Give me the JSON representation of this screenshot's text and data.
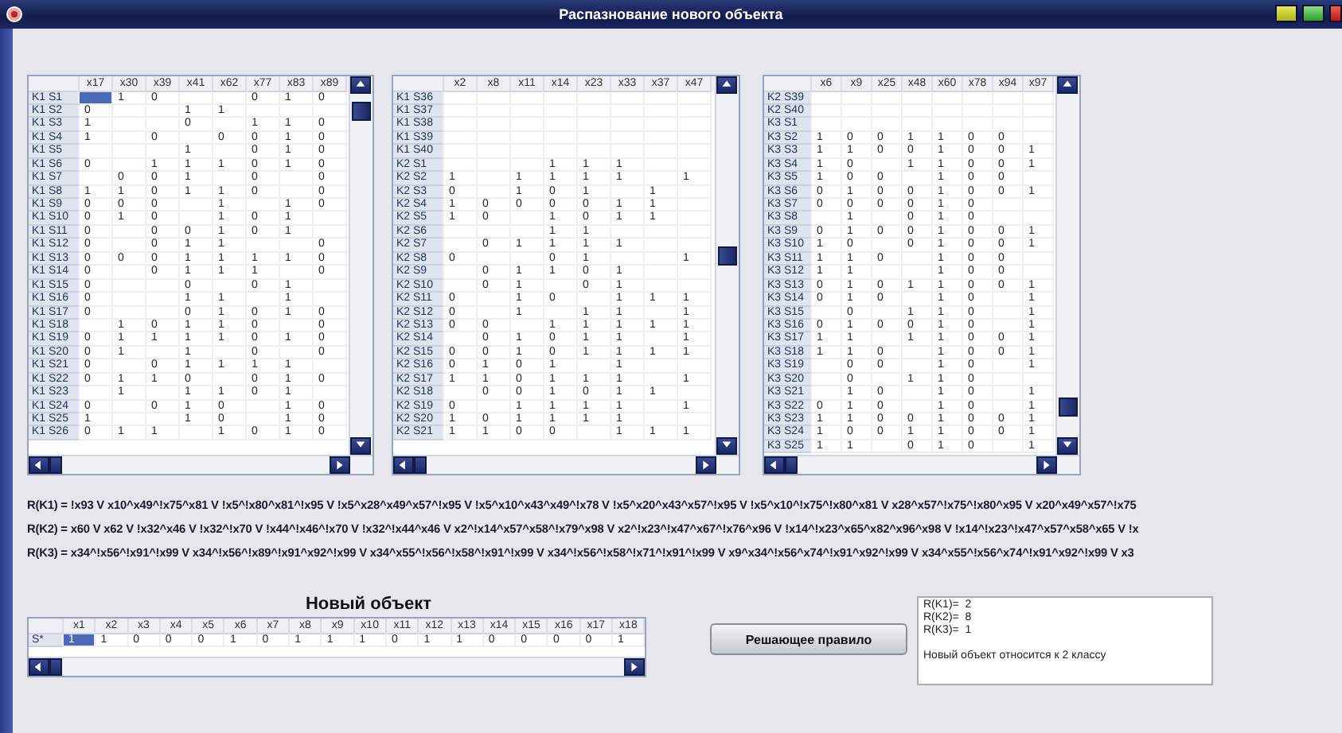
{
  "window": {
    "title": "Распазнование нового объекта"
  },
  "training_tables": [
    {
      "columns": [
        "x17",
        "x30",
        "x39",
        "x41",
        "x62",
        "x77",
        "x83",
        "x89"
      ],
      "rows": [
        {
          "label": "K1 S1",
          "selected": true,
          "cells": [
            null,
            "1",
            "0",
            null,
            null,
            "0",
            "1",
            "0"
          ]
        },
        {
          "label": "K1 S2",
          "selected": false,
          "cells": [
            "0",
            null,
            null,
            "1",
            "1",
            null,
            null,
            null
          ]
        },
        {
          "label": "K1 S3",
          "selected": false,
          "cells": [
            "1",
            null,
            null,
            "0",
            null,
            "1",
            "1",
            "0"
          ]
        },
        {
          "label": "K1 S4",
          "selected": false,
          "cells": [
            "1",
            null,
            "0",
            null,
            "0",
            "0",
            "1",
            "0"
          ]
        },
        {
          "label": "K1 S5",
          "selected": false,
          "cells": [
            null,
            null,
            null,
            "1",
            null,
            "0",
            "1",
            "0"
          ]
        },
        {
          "label": "K1 S6",
          "selected": false,
          "cells": [
            "0",
            null,
            "1",
            "1",
            "1",
            "0",
            "1",
            "0"
          ]
        },
        {
          "label": "K1 S7",
          "selected": false,
          "cells": [
            null,
            "0",
            "0",
            "1",
            null,
            "0",
            null,
            "0"
          ]
        },
        {
          "label": "K1 S8",
          "selected": false,
          "cells": [
            "1",
            "1",
            "0",
            "1",
            "1",
            "0",
            null,
            "0"
          ]
        },
        {
          "label": "K1 S9",
          "selected": false,
          "cells": [
            "0",
            "0",
            "0",
            null,
            "1",
            null,
            "1",
            "0"
          ]
        },
        {
          "label": "K1 S10",
          "selected": false,
          "cells": [
            "0",
            "1",
            "0",
            null,
            "1",
            "0",
            "1",
            null
          ]
        },
        {
          "label": "K1 S11",
          "selected": false,
          "cells": [
            "0",
            null,
            "0",
            "0",
            "1",
            "0",
            "1",
            null
          ]
        },
        {
          "label": "K1 S12",
          "selected": false,
          "cells": [
            "0",
            null,
            "0",
            "1",
            "1",
            null,
            null,
            "0"
          ]
        },
        {
          "label": "K1 S13",
          "selected": false,
          "cells": [
            "0",
            "0",
            "0",
            "1",
            "1",
            "1",
            "1",
            "0"
          ]
        },
        {
          "label": "K1 S14",
          "selected": false,
          "cells": [
            "0",
            null,
            "0",
            "1",
            "1",
            "1",
            null,
            "0"
          ]
        },
        {
          "label": "K1 S15",
          "selected": false,
          "cells": [
            "0",
            null,
            null,
            "0",
            null,
            "0",
            "1",
            null
          ]
        },
        {
          "label": "K1 S16",
          "selected": false,
          "cells": [
            "0",
            null,
            null,
            "1",
            "1",
            null,
            "1",
            null
          ]
        },
        {
          "label": "K1 S17",
          "selected": false,
          "cells": [
            "0",
            null,
            null,
            "0",
            "1",
            "0",
            "1",
            "0"
          ]
        },
        {
          "label": "K1 S18",
          "selected": false,
          "cells": [
            null,
            "1",
            "0",
            "1",
            "1",
            "0",
            null,
            "0"
          ]
        },
        {
          "label": "K1 S19",
          "selected": false,
          "cells": [
            "0",
            "1",
            "1",
            "1",
            "1",
            "0",
            "1",
            "0"
          ]
        },
        {
          "label": "K1 S20",
          "selected": false,
          "cells": [
            "0",
            "1",
            null,
            "1",
            null,
            "0",
            null,
            "0"
          ]
        },
        {
          "label": "K1 S21",
          "selected": false,
          "cells": [
            "0",
            null,
            "0",
            "1",
            "1",
            "1",
            "1",
            null
          ]
        },
        {
          "label": "K1 S22",
          "selected": false,
          "cells": [
            "0",
            "1",
            "1",
            "0",
            null,
            "0",
            "1",
            "0"
          ]
        },
        {
          "label": "K1 S23",
          "selected": false,
          "cells": [
            null,
            "1",
            null,
            "1",
            "1",
            "0",
            "1",
            null
          ]
        },
        {
          "label": "K1 S24",
          "selected": false,
          "cells": [
            "0",
            null,
            "0",
            "1",
            "0",
            null,
            "1",
            "0"
          ]
        },
        {
          "label": "K1 S25",
          "selected": false,
          "cells": [
            "1",
            null,
            null,
            "1",
            "0",
            null,
            "1",
            "0"
          ]
        },
        {
          "label": "K1 S26",
          "selected": false,
          "cells": [
            "0",
            "1",
            "1",
            null,
            "1",
            "0",
            "1",
            "0"
          ]
        }
      ]
    },
    {
      "columns": [
        "x2",
        "x8",
        "x11",
        "x14",
        "x23",
        "x33",
        "x37",
        "x47"
      ],
      "rows": [
        {
          "label": "K1 S36",
          "selected": false,
          "cells": [
            null,
            null,
            null,
            null,
            null,
            null,
            null,
            null
          ]
        },
        {
          "label": "K1 S37",
          "selected": false,
          "cells": [
            null,
            null,
            null,
            null,
            null,
            null,
            null,
            null
          ]
        },
        {
          "label": "K1 S38",
          "selected": false,
          "cells": [
            null,
            null,
            null,
            null,
            null,
            null,
            null,
            null
          ]
        },
        {
          "label": "K1 S39",
          "selected": false,
          "cells": [
            null,
            null,
            null,
            null,
            null,
            null,
            null,
            null
          ]
        },
        {
          "label": "K1 S40",
          "selected": false,
          "cells": [
            null,
            null,
            null,
            null,
            null,
            null,
            null,
            null
          ]
        },
        {
          "label": "K2 S1",
          "selected": false,
          "cells": [
            null,
            null,
            null,
            "1",
            "1",
            "1",
            null,
            null
          ]
        },
        {
          "label": "K2 S2",
          "selected": false,
          "cells": [
            "1",
            null,
            "1",
            "1",
            "1",
            "1",
            null,
            "1"
          ]
        },
        {
          "label": "K2 S3",
          "selected": false,
          "cells": [
            "0",
            null,
            "1",
            "0",
            "1",
            null,
            "1",
            null
          ]
        },
        {
          "label": "K2 S4",
          "selected": false,
          "cells": [
            "1",
            "0",
            "0",
            "0",
            "0",
            "1",
            "1",
            null
          ]
        },
        {
          "label": "K2 S5",
          "selected": false,
          "cells": [
            "1",
            "0",
            null,
            "1",
            "0",
            "1",
            "1",
            null
          ]
        },
        {
          "label": "K2 S6",
          "selected": false,
          "cells": [
            null,
            null,
            null,
            "1",
            "1",
            null,
            null,
            null
          ]
        },
        {
          "label": "K2 S7",
          "selected": false,
          "cells": [
            null,
            "0",
            "1",
            "1",
            "1",
            "1",
            null,
            null
          ]
        },
        {
          "label": "K2 S8",
          "selected": false,
          "cells": [
            "0",
            null,
            null,
            "0",
            "1",
            null,
            null,
            "1"
          ]
        },
        {
          "label": "K2 S9",
          "selected": false,
          "cells": [
            null,
            "0",
            "1",
            "1",
            "0",
            "1",
            null,
            null
          ]
        },
        {
          "label": "K2 S10",
          "selected": false,
          "cells": [
            null,
            "0",
            "1",
            null,
            "0",
            "1",
            null,
            null
          ]
        },
        {
          "label": "K2 S11",
          "selected": false,
          "cells": [
            "0",
            null,
            "1",
            "0",
            null,
            "1",
            "1",
            "1"
          ]
        },
        {
          "label": "K2 S12",
          "selected": false,
          "cells": [
            "0",
            null,
            "1",
            null,
            "1",
            "1",
            null,
            "1"
          ]
        },
        {
          "label": "K2 S13",
          "selected": false,
          "cells": [
            "0",
            "0",
            null,
            "1",
            "1",
            "1",
            "1",
            "1"
          ]
        },
        {
          "label": "K2 S14",
          "selected": false,
          "cells": [
            null,
            "0",
            "1",
            "0",
            "1",
            "1",
            null,
            "1"
          ]
        },
        {
          "label": "K2 S15",
          "selected": false,
          "cells": [
            "0",
            "0",
            "1",
            "0",
            "1",
            "1",
            "1",
            "1"
          ]
        },
        {
          "label": "K2 S16",
          "selected": false,
          "cells": [
            "0",
            "1",
            "0",
            "1",
            null,
            "1",
            null,
            null
          ]
        },
        {
          "label": "K2 S17",
          "selected": false,
          "cells": [
            "1",
            "1",
            "0",
            "1",
            "1",
            "1",
            null,
            "1"
          ]
        },
        {
          "label": "K2 S18",
          "selected": false,
          "cells": [
            null,
            "0",
            "0",
            "1",
            "0",
            "1",
            "1",
            null
          ]
        },
        {
          "label": "K2 S19",
          "selected": false,
          "cells": [
            "0",
            null,
            "1",
            "1",
            "1",
            "1",
            null,
            "1"
          ]
        },
        {
          "label": "K2 S20",
          "selected": false,
          "cells": [
            "1",
            "0",
            "1",
            "1",
            "1",
            "1",
            null,
            null
          ]
        },
        {
          "label": "K2 S21",
          "selected": false,
          "cells": [
            "1",
            "1",
            "0",
            "0",
            null,
            "1",
            "1",
            "1"
          ]
        }
      ]
    },
    {
      "columns": [
        "x6",
        "x9",
        "x25",
        "x48",
        "x60",
        "x78",
        "x94",
        "x97"
      ],
      "rows": [
        {
          "label": "K2 S39",
          "selected": false,
          "cells": [
            null,
            null,
            null,
            null,
            null,
            null,
            null,
            null
          ]
        },
        {
          "label": "K2 S40",
          "selected": false,
          "cells": [
            null,
            null,
            null,
            null,
            null,
            null,
            null,
            null
          ]
        },
        {
          "label": "K3 S1",
          "selected": false,
          "cells": [
            null,
            null,
            null,
            null,
            null,
            null,
            null,
            null
          ]
        },
        {
          "label": "K3 S2",
          "selected": false,
          "cells": [
            "1",
            "0",
            "0",
            "1",
            "1",
            "0",
            "0",
            null
          ]
        },
        {
          "label": "K3 S3",
          "selected": false,
          "cells": [
            "1",
            "1",
            "0",
            "0",
            "1",
            "0",
            "0",
            "1"
          ]
        },
        {
          "label": "K3 S4",
          "selected": false,
          "cells": [
            "1",
            "0",
            null,
            "1",
            "1",
            "0",
            "0",
            "1"
          ]
        },
        {
          "label": "K3 S5",
          "selected": false,
          "cells": [
            "1",
            "0",
            "0",
            null,
            "1",
            "0",
            "0",
            null
          ]
        },
        {
          "label": "K3 S6",
          "selected": false,
          "cells": [
            "0",
            "1",
            "0",
            "0",
            "1",
            "0",
            "0",
            "1"
          ]
        },
        {
          "label": "K3 S7",
          "selected": false,
          "cells": [
            "0",
            "0",
            "0",
            "0",
            "1",
            "0",
            null,
            null
          ]
        },
        {
          "label": "K3 S8",
          "selected": false,
          "cells": [
            null,
            "1",
            null,
            "0",
            "1",
            "0",
            null,
            null
          ]
        },
        {
          "label": "K3 S9",
          "selected": false,
          "cells": [
            "0",
            "1",
            "0",
            "0",
            "1",
            "0",
            "0",
            "1"
          ]
        },
        {
          "label": "K3 S10",
          "selected": false,
          "cells": [
            "1",
            "0",
            null,
            "0",
            "1",
            "0",
            "0",
            "1"
          ]
        },
        {
          "label": "K3 S11",
          "selected": false,
          "cells": [
            "1",
            "1",
            "0",
            null,
            "1",
            "0",
            "0",
            null
          ]
        },
        {
          "label": "K3 S12",
          "selected": false,
          "cells": [
            "1",
            "1",
            null,
            null,
            "1",
            "0",
            "0",
            null
          ]
        },
        {
          "label": "K3 S13",
          "selected": false,
          "cells": [
            "0",
            "1",
            "0",
            "1",
            "1",
            "0",
            "0",
            "1"
          ]
        },
        {
          "label": "K3 S14",
          "selected": false,
          "cells": [
            "0",
            "1",
            "0",
            null,
            "1",
            "0",
            null,
            "1"
          ]
        },
        {
          "label": "K3 S15",
          "selected": false,
          "cells": [
            null,
            "0",
            null,
            "1",
            "1",
            "0",
            null,
            "1"
          ]
        },
        {
          "label": "K3 S16",
          "selected": false,
          "cells": [
            "0",
            "1",
            "0",
            "0",
            "1",
            "0",
            null,
            "1"
          ]
        },
        {
          "label": "K3 S17",
          "selected": false,
          "cells": [
            "1",
            "1",
            null,
            "1",
            "1",
            "0",
            "0",
            "1"
          ]
        },
        {
          "label": "K3 S18",
          "selected": false,
          "cells": [
            "1",
            "1",
            "0",
            null,
            "1",
            "0",
            "0",
            "1"
          ]
        },
        {
          "label": "K3 S19",
          "selected": false,
          "cells": [
            null,
            "0",
            "0",
            null,
            "1",
            "0",
            null,
            "1"
          ]
        },
        {
          "label": "K3 S20",
          "selected": false,
          "cells": [
            null,
            "0",
            null,
            "1",
            "1",
            "0",
            null,
            null
          ]
        },
        {
          "label": "K3 S21",
          "selected": false,
          "cells": [
            null,
            "1",
            "0",
            null,
            "1",
            "0",
            null,
            "1"
          ]
        },
        {
          "label": "K3 S22",
          "selected": false,
          "cells": [
            "0",
            "1",
            "0",
            null,
            "1",
            "0",
            null,
            "1"
          ]
        },
        {
          "label": "K3 S23",
          "selected": false,
          "cells": [
            "1",
            "1",
            "0",
            "0",
            "1",
            "0",
            "0",
            "1"
          ]
        },
        {
          "label": "K3 S24",
          "selected": false,
          "cells": [
            "1",
            "0",
            "0",
            "1",
            "1",
            "0",
            "0",
            "1"
          ]
        },
        {
          "label": "K3 S25",
          "selected": false,
          "cells": [
            "1",
            "1",
            null,
            "0",
            "1",
            "0",
            null,
            "1"
          ]
        }
      ]
    }
  ],
  "rules": [
    "R(K1) = !x93 V x10^x49^!x75^x81 V !x5^!x80^x81^!x95 V !x5^x28^x49^x57^!x95 V !x5^x10^x43^x49^!x78 V !x5^x20^x43^x57^!x95 V !x5^x10^!x75^!x80^x81 V x28^x57^!x75^!x80^x95 V x20^x49^x57^!x75",
    "R(K2) = x60 V x62 V !x32^x46 V !x32^!x70 V !x44^!x46^!x70 V !x32^!x44^x46 V  x2^!x14^x57^x58^!x79^x98 V x2^!x23^!x47^x67^!x76^x96 V !x14^!x23^x65^x82^x96^x98 V !x14^!x23^!x47^x57^x58^x65 V !x",
    "R(K3) = x34^!x56^!x91^!x99 V x34^!x56^!x89^!x91^x92^!x99 V x34^x55^!x56^!x58^!x91^!x99 V x34^!x56^!x58^!x71^!x91^!x99 V x9^x34^!x56^x74^!x91^x92^!x99 V x34^x55^!x56^x74^!x91^x92^!x99 V x3"
  ],
  "new_object": {
    "title": "Новый объект",
    "columns": [
      "x1",
      "x2",
      "x3",
      "x4",
      "x5",
      "x6",
      "x7",
      "x8",
      "x9",
      "x10",
      "x11",
      "x12",
      "x13",
      "x14",
      "x15",
      "x16",
      "x17",
      "x18"
    ],
    "rows": [
      {
        "label": "S*",
        "selected": true,
        "cells": [
          "1",
          "1",
          "0",
          "0",
          "0",
          "1",
          "0",
          "1",
          "1",
          "1",
          "0",
          "1",
          "1",
          "0",
          "0",
          "0",
          "0",
          "1"
        ]
      }
    ]
  },
  "decide_button": "Решающее правило",
  "result": {
    "lines": [
      "R(K1)=  2",
      "R(K2)=  8",
      "R(K3)=  1"
    ],
    "conclusion": "Новый объект относится к 2 классу"
  }
}
